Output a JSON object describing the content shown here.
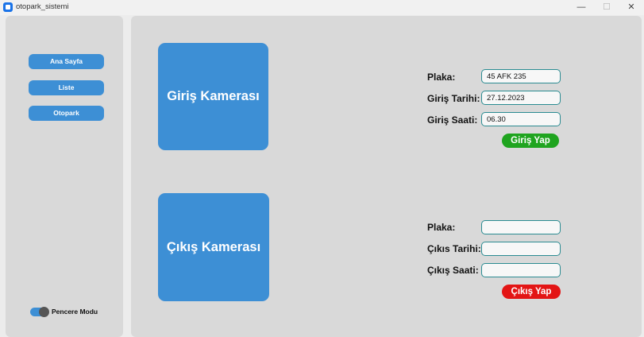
{
  "window": {
    "title": "otopark_sistemi",
    "minimize": "—",
    "maximize": "☐",
    "close": "✕"
  },
  "sidebar": {
    "items": [
      {
        "label": "Ana Sayfa"
      },
      {
        "label": "Liste"
      },
      {
        "label": "Otopark"
      }
    ],
    "mode_switch": {
      "label": "Pencere Modu",
      "on": true
    }
  },
  "entry": {
    "camera_label": "Giriş Kamerası",
    "plate_label": "Plaka:",
    "plate_value": "45 AFK 235",
    "date_label": "Giriş Tarihi:",
    "date_value": "27.12.2023",
    "time_label": "Giriş Saati:",
    "time_value": "06.30",
    "button": "Giriş Yap"
  },
  "exit": {
    "camera_label": "Çıkış Kamerası",
    "plate_label": "Plaka:",
    "plate_value": "",
    "date_label": "Çıkıs Tarihi:",
    "date_value": "",
    "time_label": "Çıkış Saati:",
    "time_value": "",
    "button": "Çıkış Yap"
  },
  "colors": {
    "accent": "#3d8fd5",
    "enter": "#1fa41f",
    "exit": "#e31515",
    "field_border": "#2a8b91"
  }
}
